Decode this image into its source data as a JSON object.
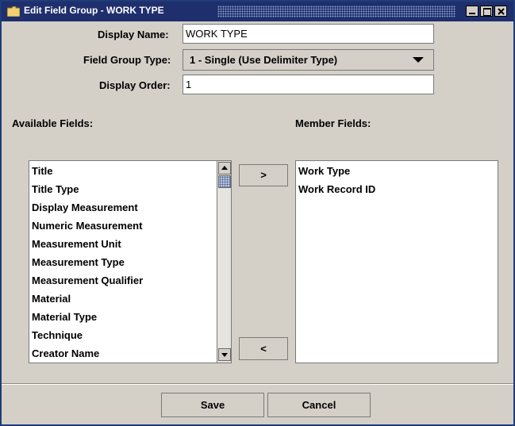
{
  "window": {
    "title": "Edit Field Group - WORK TYPE"
  },
  "form": {
    "display_name_label": "Display Name:",
    "display_name_value": "WORK TYPE",
    "field_group_type_label": "Field Group Type:",
    "field_group_type_value": "1 - Single (Use Delimiter Type)",
    "display_order_label": "Display Order:",
    "display_order_value": "1"
  },
  "available": {
    "label": "Available Fields:",
    "items": [
      "Title",
      "Title Type",
      "Display Measurement",
      "Numeric Measurement",
      "Measurement Unit",
      "Measurement Type",
      "Measurement Qualifier",
      "Material",
      "Material Type",
      "Technique",
      "Creator Name"
    ]
  },
  "member": {
    "label": "Member Fields:",
    "items": [
      "Work Type",
      "Work Record ID"
    ]
  },
  "buttons": {
    "add": ">",
    "remove": "<",
    "save": "Save",
    "cancel": "Cancel"
  },
  "icons": {
    "title_icon": "folder-icon"
  }
}
